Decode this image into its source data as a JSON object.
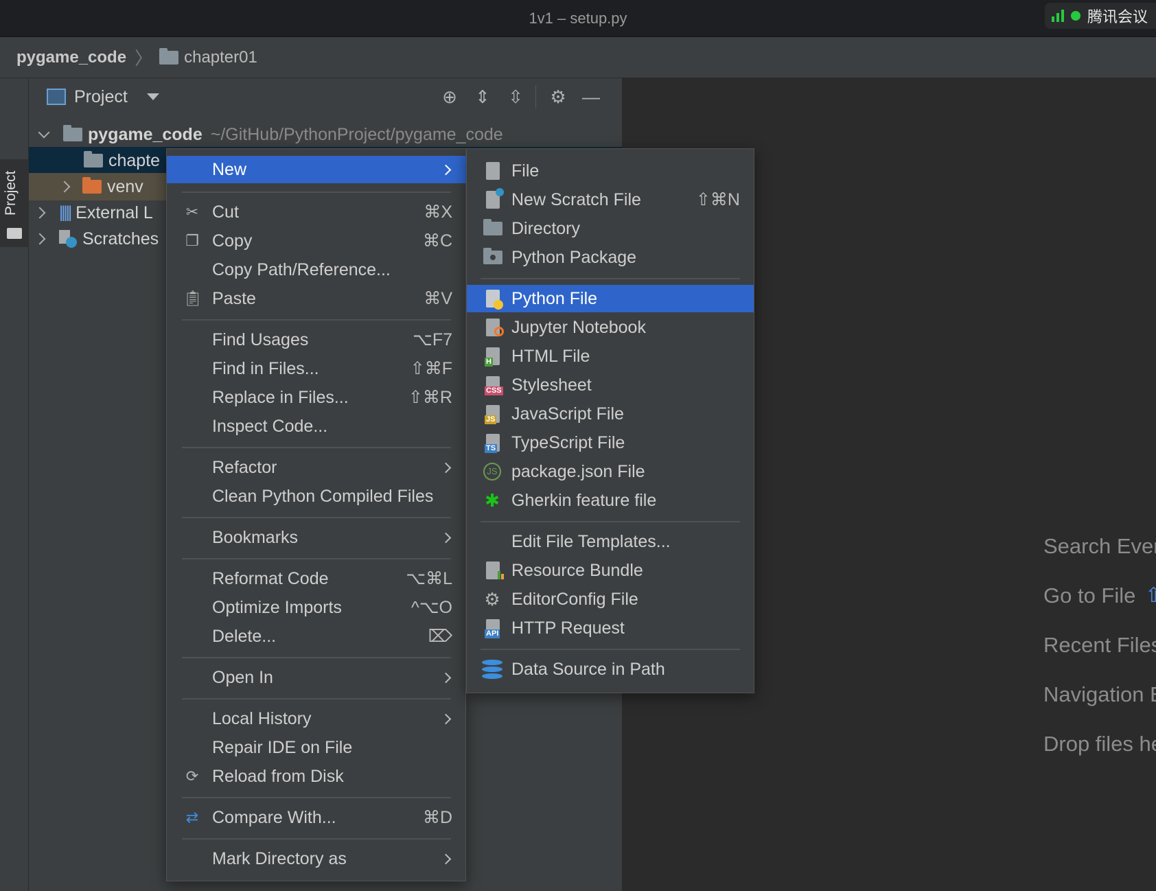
{
  "window": {
    "title": "1v1 – setup.py",
    "meeting_indicator": "腾讯会议"
  },
  "breadcrumb": {
    "root": "pygame_code",
    "folder": "chapter01"
  },
  "tool_window": {
    "stripe_label": "Project"
  },
  "project_panel": {
    "title": "Project",
    "tree": {
      "root_name": "pygame_code",
      "root_path": "~/GitHub/PythonProject/pygame_code",
      "selected_folder": "chapte",
      "venv": "venv",
      "external": "External L",
      "scratches": "Scratches"
    }
  },
  "context_menu": {
    "items": [
      {
        "label": "New",
        "shortcut": ""
      },
      {
        "label": "Cut",
        "shortcut": "⌘X"
      },
      {
        "label": "Copy",
        "shortcut": "⌘C"
      },
      {
        "label": "Copy Path/Reference...",
        "shortcut": ""
      },
      {
        "label": "Paste",
        "shortcut": "⌘V"
      },
      {
        "label": "Find Usages",
        "shortcut": "⌥F7"
      },
      {
        "label": "Find in Files...",
        "shortcut": "⇧⌘F"
      },
      {
        "label": "Replace in Files...",
        "shortcut": "⇧⌘R"
      },
      {
        "label": "Inspect Code...",
        "shortcut": ""
      },
      {
        "label": "Refactor",
        "shortcut": ""
      },
      {
        "label": "Clean Python Compiled Files",
        "shortcut": ""
      },
      {
        "label": "Bookmarks",
        "shortcut": ""
      },
      {
        "label": "Reformat Code",
        "shortcut": "⌥⌘L"
      },
      {
        "label": "Optimize Imports",
        "shortcut": "^⌥O"
      },
      {
        "label": "Delete...",
        "shortcut": "⌦"
      },
      {
        "label": "Open In",
        "shortcut": ""
      },
      {
        "label": "Local History",
        "shortcut": ""
      },
      {
        "label": "Repair IDE on File",
        "shortcut": ""
      },
      {
        "label": "Reload from Disk",
        "shortcut": ""
      },
      {
        "label": "Compare With...",
        "shortcut": "⌘D"
      },
      {
        "label": "Mark Directory as",
        "shortcut": ""
      }
    ]
  },
  "new_submenu": {
    "items": [
      {
        "label": "File",
        "shortcut": ""
      },
      {
        "label": "New Scratch File",
        "shortcut": "⇧⌘N"
      },
      {
        "label": "Directory",
        "shortcut": ""
      },
      {
        "label": "Python Package",
        "shortcut": ""
      },
      {
        "label": "Python File",
        "shortcut": ""
      },
      {
        "label": "Jupyter Notebook",
        "shortcut": ""
      },
      {
        "label": "HTML File",
        "shortcut": ""
      },
      {
        "label": "Stylesheet",
        "shortcut": ""
      },
      {
        "label": "JavaScript File",
        "shortcut": ""
      },
      {
        "label": "TypeScript File",
        "shortcut": ""
      },
      {
        "label": "package.json File",
        "shortcut": ""
      },
      {
        "label": "Gherkin feature file",
        "shortcut": ""
      },
      {
        "label": "Edit File Templates...",
        "shortcut": ""
      },
      {
        "label": "Resource Bundle",
        "shortcut": ""
      },
      {
        "label": "EditorConfig File",
        "shortcut": ""
      },
      {
        "label": "HTTP Request",
        "shortcut": ""
      },
      {
        "label": "Data Source in Path",
        "shortcut": ""
      }
    ]
  },
  "welcome_hints": [
    "Search Ever",
    "Go to File",
    "Recent Files",
    "Navigation E",
    "Drop files he"
  ],
  "colors": {
    "selection": "#2f65ca",
    "panel": "#3c3f41",
    "editor": "#2b2b2b"
  }
}
